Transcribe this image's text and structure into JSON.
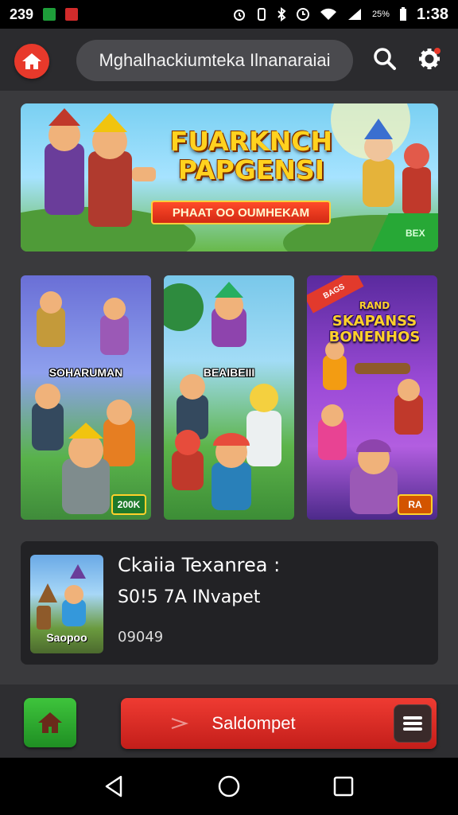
{
  "status_bar": {
    "left_text": "239",
    "time": "1:38",
    "battery_text": "25%",
    "colors": {
      "app_green": "#1e9e3a",
      "app_red": "#d22b2b"
    }
  },
  "app_bar": {
    "search_text": "Mghalhackiumteka Ilnanaraiai",
    "icons": [
      "home-icon",
      "search-icon",
      "gear-icon"
    ],
    "accent": "#e8392b"
  },
  "banner": {
    "title_line1": "FUARKNCH",
    "title_line2": "PAPGENSI",
    "subtitle": "PHAAT OO OUMHEKAM",
    "corner_tag": "BEX"
  },
  "cards": [
    {
      "label": "SOHARUMAN",
      "badge": "200K"
    },
    {
      "label": "BEAIBEIII"
    },
    {
      "title": "SKAPANSS BONENHOS",
      "ribbon": "BAGS",
      "top_label": "RAND",
      "badge": "RA"
    }
  ],
  "info_panel": {
    "thumb_label": "Saopoo",
    "title": "Ckaiia Texanrea :",
    "subtitle": "S0!5 7A INvapet",
    "meta": "09049"
  },
  "action_bar": {
    "button_label": "Saldompet",
    "icons": [
      "home-icon",
      "menu-icon"
    ]
  },
  "nav_bar": {
    "icons": [
      "back-icon",
      "home-circle-icon",
      "recents-icon"
    ]
  }
}
